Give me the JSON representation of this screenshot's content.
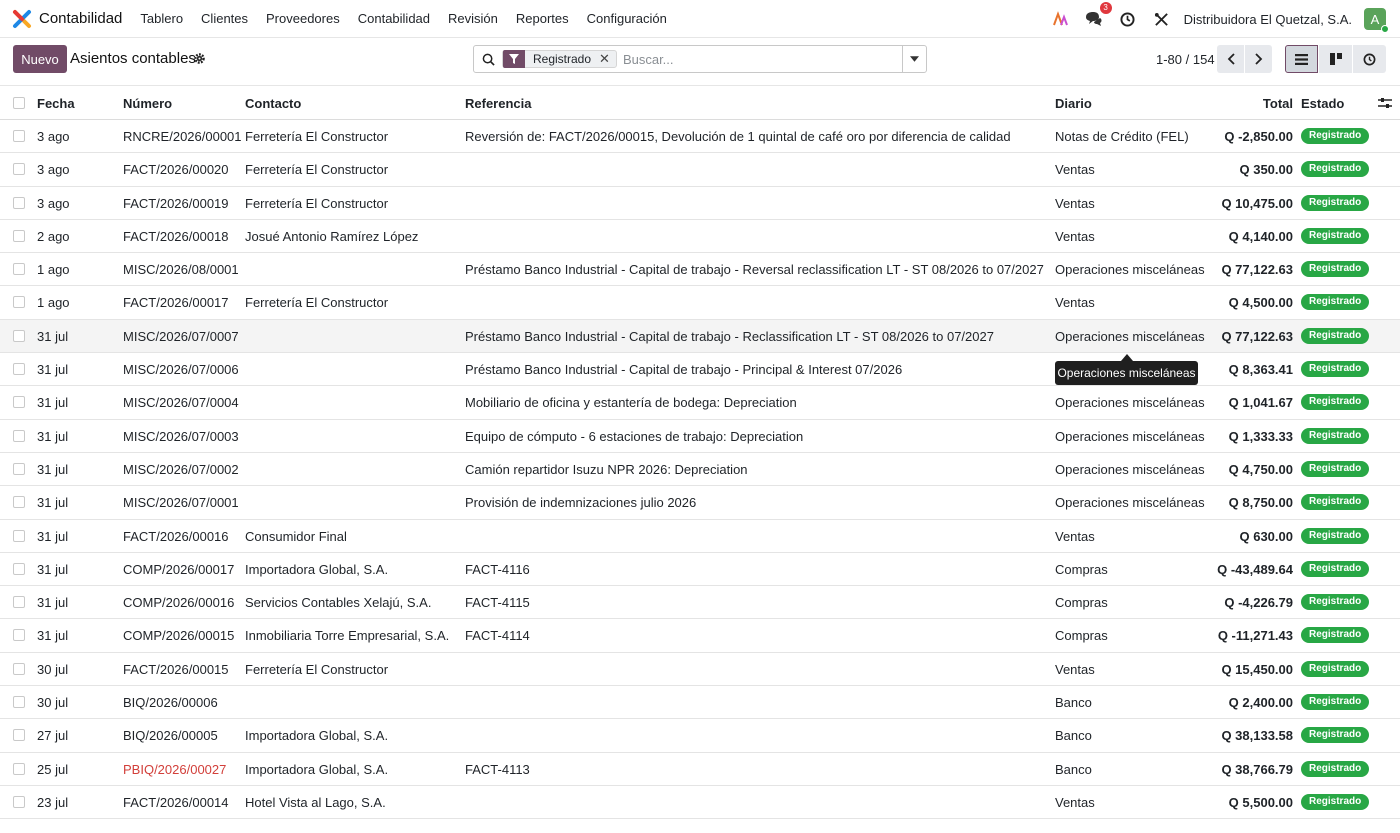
{
  "navbar": {
    "app_name": "Contabilidad",
    "menu": [
      "Tablero",
      "Clientes",
      "Proveedores",
      "Contabilidad",
      "Revisión",
      "Reportes",
      "Configuración"
    ],
    "message_count": "3",
    "company": "Distribuidora El Quetzal, S.A.",
    "avatar_initial": "A"
  },
  "control": {
    "new_label": "Nuevo",
    "title": "Asientos contables",
    "facet_label": "Registrado",
    "facet_remove": "✕",
    "search_placeholder": "Buscar...",
    "pager": "1-80 / 154"
  },
  "table": {
    "headers": {
      "date": "Fecha",
      "number": "Número",
      "contact": "Contacto",
      "reference": "Referencia",
      "journal": "Diario",
      "total": "Total",
      "status": "Estado"
    },
    "rows": [
      {
        "date": "3 ago",
        "number": "RNCRE/2026/00001",
        "contact": "Ferretería El Constructor",
        "reference": "Reversión de: FACT/2026/00015, Devolución de 1 quintal de café oro por diferencia de calidad",
        "journal": "Notas de Crédito (FEL)",
        "total": "Q -2,850.00",
        "status": "Registrado"
      },
      {
        "date": "3 ago",
        "number": "FACT/2026/00020",
        "contact": "Ferretería El Constructor",
        "reference": "",
        "journal": "Ventas",
        "total": "Q 350.00",
        "status": "Registrado"
      },
      {
        "date": "3 ago",
        "number": "FACT/2026/00019",
        "contact": "Ferretería El Constructor",
        "reference": "",
        "journal": "Ventas",
        "total": "Q 10,475.00",
        "status": "Registrado"
      },
      {
        "date": "2 ago",
        "number": "FACT/2026/00018",
        "contact": "Josué Antonio Ramírez López",
        "reference": "",
        "journal": "Ventas",
        "total": "Q 4,140.00",
        "status": "Registrado"
      },
      {
        "date": "1 ago",
        "number": "MISC/2026/08/0001",
        "contact": "",
        "reference": "Préstamo Banco Industrial - Capital de trabajo - Reversal reclassification LT - ST 08/2026 to 07/2027",
        "journal": "Operaciones misceláneas",
        "total": "Q 77,122.63",
        "status": "Registrado"
      },
      {
        "date": "1 ago",
        "number": "FACT/2026/00017",
        "contact": "Ferretería El Constructor",
        "reference": "",
        "journal": "Ventas",
        "total": "Q 4,500.00",
        "status": "Registrado"
      },
      {
        "date": "31 jul",
        "number": "MISC/2026/07/0007",
        "contact": "",
        "reference": "Préstamo Banco Industrial - Capital de trabajo - Reclassification LT - ST 08/2026 to 07/2027",
        "journal": "Operaciones misceláneas",
        "total": "Q 77,122.63",
        "status": "Registrado"
      },
      {
        "date": "31 jul",
        "number": "MISC/2026/07/0006",
        "contact": "",
        "reference": "Préstamo Banco Industrial - Capital de trabajo - Principal & Interest 07/2026",
        "journal": "",
        "total": "Q 8,363.41",
        "status": "Registrado"
      },
      {
        "date": "31 jul",
        "number": "MISC/2026/07/0004",
        "contact": "",
        "reference": "Mobiliario de oficina y estantería de bodega: Depreciation",
        "journal": "Operaciones misceláneas",
        "total": "Q 1,041.67",
        "status": "Registrado"
      },
      {
        "date": "31 jul",
        "number": "MISC/2026/07/0003",
        "contact": "",
        "reference": "Equipo de cómputo - 6 estaciones de trabajo: Depreciation",
        "journal": "Operaciones misceláneas",
        "total": "Q 1,333.33",
        "status": "Registrado"
      },
      {
        "date": "31 jul",
        "number": "MISC/2026/07/0002",
        "contact": "",
        "reference": "Camión repartidor Isuzu NPR 2026: Depreciation",
        "journal": "Operaciones misceláneas",
        "total": "Q 4,750.00",
        "status": "Registrado"
      },
      {
        "date": "31 jul",
        "number": "MISC/2026/07/0001",
        "contact": "",
        "reference": "Provisión de indemnizaciones julio 2026",
        "journal": "Operaciones misceláneas",
        "total": "Q 8,750.00",
        "status": "Registrado"
      },
      {
        "date": "31 jul",
        "number": "FACT/2026/00016",
        "contact": "Consumidor Final",
        "reference": "",
        "journal": "Ventas",
        "total": "Q 630.00",
        "status": "Registrado"
      },
      {
        "date": "31 jul",
        "number": "COMP/2026/00017",
        "contact": "Importadora Global, S.A.",
        "reference": "FACT-4116",
        "journal": "Compras",
        "total": "Q -43,489.64",
        "status": "Registrado"
      },
      {
        "date": "31 jul",
        "number": "COMP/2026/00016",
        "contact": "Servicios Contables Xelajú, S.A.",
        "reference": "FACT-4115",
        "journal": "Compras",
        "total": "Q -4,226.79",
        "status": "Registrado"
      },
      {
        "date": "31 jul",
        "number": "COMP/2026/00015",
        "contact": "Inmobiliaria Torre Empresarial, S.A.",
        "reference": "FACT-4114",
        "journal": "Compras",
        "total": "Q -11,271.43",
        "status": "Registrado"
      },
      {
        "date": "30 jul",
        "number": "FACT/2026/00015",
        "contact": "Ferretería El Constructor",
        "reference": "",
        "journal": "Ventas",
        "total": "Q 15,450.00",
        "status": "Registrado"
      },
      {
        "date": "30 jul",
        "number": "BIQ/2026/00006",
        "contact": "",
        "reference": "",
        "journal": "Banco",
        "total": "Q 2,400.00",
        "status": "Registrado"
      },
      {
        "date": "27 jul",
        "number": "BIQ/2026/00005",
        "contact": "Importadora Global, S.A.",
        "reference": "",
        "journal": "Banco",
        "total": "Q 38,133.58",
        "status": "Registrado"
      },
      {
        "date": "25 jul",
        "number": "PBIQ/2026/00027",
        "contact": "Importadora Global, S.A.",
        "reference": "FACT-4113",
        "journal": "Banco",
        "total": "Q 38,766.79",
        "status": "Registrado"
      },
      {
        "date": "23 jul",
        "number": "FACT/2026/00014",
        "contact": "Hotel Vista al Lago, S.A.",
        "reference": "",
        "journal": "Ventas",
        "total": "Q 5,500.00",
        "status": "Registrado"
      }
    ]
  },
  "tooltip": "Operaciones misceláneas",
  "colors": {
    "brand": "#714b67",
    "status_badge": "#28a745",
    "highlight_number": "#d23f3a"
  }
}
